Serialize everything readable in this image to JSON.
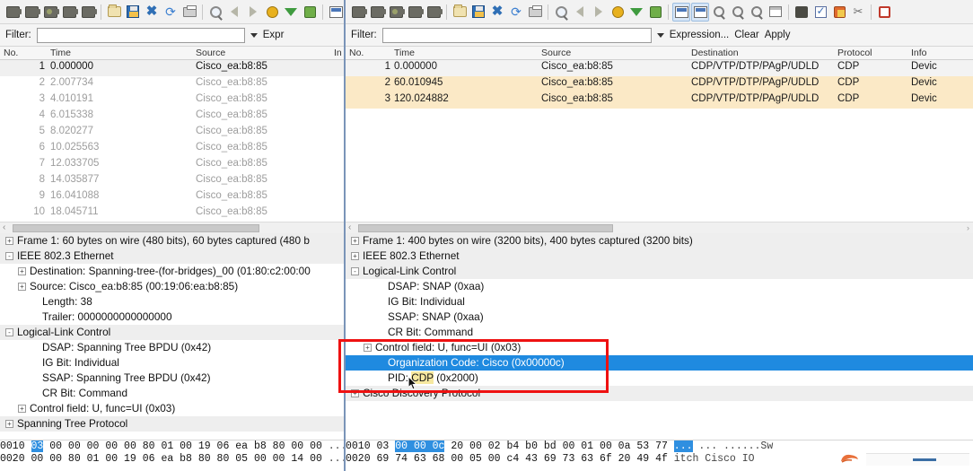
{
  "left_window": {
    "toolbar": {
      "icons": [
        "start-capture-icon",
        "capture-options-icon",
        "capture-restart-icon",
        "stop-capture-icon",
        "capture-filter-icon",
        "open-file-icon",
        "save-file-icon",
        "close-file-icon",
        "reload-file-icon",
        "print-icon",
        "find-packet-icon",
        "go-back-icon",
        "go-forward-icon",
        "go-to-packet-icon",
        "go-to-first-packet-icon",
        "go-to-last-packet-icon",
        "colorize-icon"
      ]
    },
    "filter": {
      "label": "Filter:",
      "value": "",
      "placeholder": "",
      "expression_label": "Expr"
    },
    "packet_list": {
      "columns": [
        "No.",
        "Time",
        "Source",
        "In"
      ],
      "rows": [
        {
          "no": "1",
          "time": "0.000000",
          "source": "Cisco_ea:b8:85",
          "selected": true
        },
        {
          "no": "2",
          "time": "2.007734",
          "source": "Cisco_ea:b8:85",
          "selected": false
        },
        {
          "no": "3",
          "time": "4.010191",
          "source": "Cisco_ea:b8:85",
          "selected": false
        },
        {
          "no": "4",
          "time": "6.015338",
          "source": "Cisco_ea:b8:85",
          "selected": false
        },
        {
          "no": "5",
          "time": "8.020277",
          "source": "Cisco_ea:b8:85",
          "selected": false
        },
        {
          "no": "6",
          "time": "10.025563",
          "source": "Cisco_ea:b8:85",
          "selected": false
        },
        {
          "no": "7",
          "time": "12.033705",
          "source": "Cisco_ea:b8:85",
          "selected": false
        },
        {
          "no": "8",
          "time": "14.035877",
          "source": "Cisco_ea:b8:85",
          "selected": false
        },
        {
          "no": "9",
          "time": "16.041088",
          "source": "Cisco_ea:b8:85",
          "selected": false
        },
        {
          "no": "10",
          "time": "18.045711",
          "source": "Cisco_ea:b8:85",
          "selected": false
        }
      ]
    },
    "detail_tree": [
      {
        "text": "Frame 1: 60 bytes on wire (480 bits), 60 bytes captured (480 b",
        "level": 0,
        "expander": "+",
        "proto": true
      },
      {
        "text": "IEEE 802.3 Ethernet",
        "level": 0,
        "expander": "-",
        "proto": true
      },
      {
        "text": "Destination: Spanning-tree-(for-bridges)_00 (01:80:c2:00:00",
        "level": 1,
        "expander": "+",
        "proto": false
      },
      {
        "text": "Source: Cisco_ea:b8:85 (00:19:06:ea:b8:85)",
        "level": 1,
        "expander": "+",
        "proto": false
      },
      {
        "text": "Length: 38",
        "level": 1,
        "expander": "",
        "proto": false
      },
      {
        "text": "Trailer: 0000000000000000",
        "level": 1,
        "expander": "",
        "proto": false
      },
      {
        "text": "Logical-Link Control",
        "level": 0,
        "expander": "-",
        "proto": true
      },
      {
        "text": "DSAP: Spanning Tree BPDU (0x42)",
        "level": 1,
        "expander": "",
        "proto": false
      },
      {
        "text": "IG Bit: Individual",
        "level": 1,
        "expander": "",
        "proto": false
      },
      {
        "text": "SSAP: Spanning Tree BPDU (0x42)",
        "level": 1,
        "expander": "",
        "proto": false
      },
      {
        "text": "CR Bit: Command",
        "level": 1,
        "expander": "",
        "proto": false
      },
      {
        "text": "Control field: U, func=UI (0x03)",
        "level": 1,
        "expander": "+",
        "proto": false
      },
      {
        "text": "Spanning Tree Protocol",
        "level": 0,
        "expander": "+",
        "proto": true
      }
    ],
    "hex_pane": [
      {
        "offset": "0010",
        "sel_bytes": "03",
        "bytes_a": "00 00 00 00 00 80 01",
        "bytes_b": "00 19 06 ea b8 80 00 00",
        "ascii": "........",
        "tail": "00"
      },
      {
        "offset": "0020",
        "sel_bytes": "",
        "bytes_a": "00 00 80 01 00 19 06 ea",
        "bytes_b": "b8 80 80 05 00 00 14 00",
        "ascii": "........",
        "tail": "00"
      }
    ]
  },
  "right_window": {
    "toolbar": {
      "icons": [
        "start-capture-icon",
        "capture-options-icon",
        "capture-restart-icon",
        "stop-capture-icon",
        "capture-filter-icon",
        "open-file-icon",
        "save-file-icon",
        "close-file-icon",
        "reload-file-icon",
        "print-icon",
        "find-packet-icon",
        "go-back-icon",
        "go-forward-icon",
        "go-to-packet-icon",
        "go-to-first-packet-icon",
        "go-to-last-packet-icon",
        "toggle-packet-list-icon",
        "toggle-packet-details-icon",
        "zoom-in-icon",
        "zoom-out-icon",
        "zoom-reset-icon",
        "resize-columns-icon",
        "capture-filters-icon",
        "display-filters-icon",
        "coloring-rules-icon",
        "preferences-icon",
        "help-icon"
      ]
    },
    "filter": {
      "label": "Filter:",
      "value": "",
      "placeholder": "",
      "expression_label": "Expression...",
      "clear_label": "Clear",
      "apply_label": "Apply"
    },
    "packet_list": {
      "columns": [
        "No.",
        "Time",
        "Source",
        "Destination",
        "Protocol",
        "Info"
      ],
      "rows": [
        {
          "no": "1",
          "time": "0.000000",
          "source": "Cisco_ea:b8:85",
          "destination": "CDP/VTP/DTP/PAgP/UDLD",
          "protocol": "CDP",
          "info": "Devic",
          "selected": true
        },
        {
          "no": "2",
          "time": "60.010945",
          "source": "Cisco_ea:b8:85",
          "destination": "CDP/VTP/DTP/PAgP/UDLD",
          "protocol": "CDP",
          "info": "Devic",
          "selected": false
        },
        {
          "no": "3",
          "time": "120.024882",
          "source": "Cisco_ea:b8:85",
          "destination": "CDP/VTP/DTP/PAgP/UDLD",
          "protocol": "CDP",
          "info": "Devic",
          "selected": false
        }
      ]
    },
    "detail_tree": [
      {
        "text": "Frame 1: 400 bytes on wire (3200 bits), 400 bytes captured (3200 bits)",
        "level": 0,
        "expander": "+",
        "proto": true,
        "selected": false
      },
      {
        "text": "IEEE 802.3 Ethernet",
        "level": 0,
        "expander": "+",
        "proto": true,
        "selected": false
      },
      {
        "text": "Logical-Link Control",
        "level": 0,
        "expander": "-",
        "proto": true,
        "selected": false
      },
      {
        "text": "DSAP: SNAP (0xaa)",
        "level": 1,
        "expander": "",
        "proto": false,
        "selected": false
      },
      {
        "text": "IG Bit: Individual",
        "level": 1,
        "expander": "",
        "proto": false,
        "selected": false
      },
      {
        "text": "SSAP: SNAP (0xaa)",
        "level": 1,
        "expander": "",
        "proto": false,
        "selected": false
      },
      {
        "text": "CR Bit: Command",
        "level": 1,
        "expander": "",
        "proto": false,
        "selected": false
      },
      {
        "text": "Control field: U, func=UI (0x03)",
        "level": 1,
        "expander": "+",
        "proto": false,
        "selected": false
      },
      {
        "text": "Organization Code: Cisco (0x00000c)",
        "level": 1,
        "expander": "",
        "proto": false,
        "selected": true
      },
      {
        "text": "PID: CDP (0x2000)",
        "level": 1,
        "expander": "",
        "proto": false,
        "selected": false,
        "highlight_word": "CDP"
      },
      {
        "text": "Cisco Discovery Protocol",
        "level": 0,
        "expander": "+",
        "proto": true,
        "selected": false
      }
    ],
    "hex_pane": [
      {
        "offset": "0010",
        "pre": "03",
        "sel_bytes": "00 00 0c",
        "bytes_a": "20 00 02 b4",
        "bytes_b": "b0 bd 00 01 00 0a 53 77",
        "ascii_sel": "...",
        "ascii": "... ......Sw"
      },
      {
        "offset": "0020",
        "pre": "",
        "sel_bytes": "",
        "bytes_a": "69 74 63 68 00 05 00 c4",
        "bytes_b": "43 69 73 63 6f 20 49 4f",
        "ascii_sel": "",
        "ascii": "itch     Cisco IO"
      }
    ]
  },
  "annotation": {
    "redbox_label": "highlight-rectangle",
    "color": "#ee1111"
  }
}
